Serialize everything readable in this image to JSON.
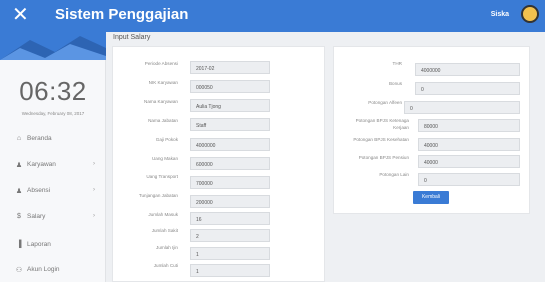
{
  "header": {
    "close_icon": "close-icon",
    "title": "Sistem Penggajian",
    "user": "Siska"
  },
  "sidebar": {
    "clock": "06:32",
    "date": "Wednesday, February 08, 2017",
    "items": [
      {
        "label": "Beranda",
        "icon": "home-icon",
        "glyph": "⌂",
        "chevron": ""
      },
      {
        "label": "Karyawan",
        "icon": "user-icon",
        "glyph": "♟",
        "chevron": "›"
      },
      {
        "label": "Absensi",
        "icon": "user-icon",
        "glyph": "♟",
        "chevron": "›"
      },
      {
        "label": "Salary",
        "icon": "dollar-icon",
        "glyph": "$",
        "chevron": "›"
      },
      {
        "label": "Laporan",
        "icon": "chart-icon",
        "glyph": "▐",
        "chevron": ""
      },
      {
        "label": "Akun Login",
        "icon": "users-icon",
        "glyph": "⚇",
        "chevron": ""
      }
    ]
  },
  "main": {
    "section_title": "Input Salary",
    "left_fields": [
      {
        "label": "Periode Absensi",
        "value": "2017-02"
      },
      {
        "label": "NIK Karyawan",
        "value": "000050"
      },
      {
        "label": "Nama Karyawan",
        "value": "Aulia Tjong"
      },
      {
        "label": "Nama Jabatan",
        "value": "Staff"
      },
      {
        "label": "Gaji Pokok",
        "value": "4000000"
      },
      {
        "label": "Uang Makan",
        "value": "600000"
      },
      {
        "label": "Uang Transport",
        "value": "700000"
      },
      {
        "label": "Tunjangan Jabatan",
        "value": "200000"
      },
      {
        "label": "Jumlah Masuk",
        "value": "16"
      },
      {
        "label": "Jumlah Sakit",
        "value": "2"
      },
      {
        "label": "Jumlah Ijin",
        "value": "1"
      },
      {
        "label": "Jumlah Cuti",
        "value": "1"
      }
    ],
    "right_fields": [
      {
        "label": "THR",
        "value": "4000000"
      },
      {
        "label": "Bonus",
        "value": "0"
      },
      {
        "label": "Potongan Alfeen",
        "value": "0"
      },
      {
        "label": "Potongan BPJS Ketenaga\nKerjaan",
        "value": "80000"
      },
      {
        "label": "Potongan BPJS Kesehatan",
        "value": "40000"
      },
      {
        "label": "Potongan BPJS Pensiun",
        "value": "40000"
      },
      {
        "label": "Potongan Lain",
        "value": "0"
      }
    ],
    "submit_label": "Kembali"
  },
  "colors": {
    "accent": "#3a7bd5",
    "input_bg": "#eceef1"
  }
}
